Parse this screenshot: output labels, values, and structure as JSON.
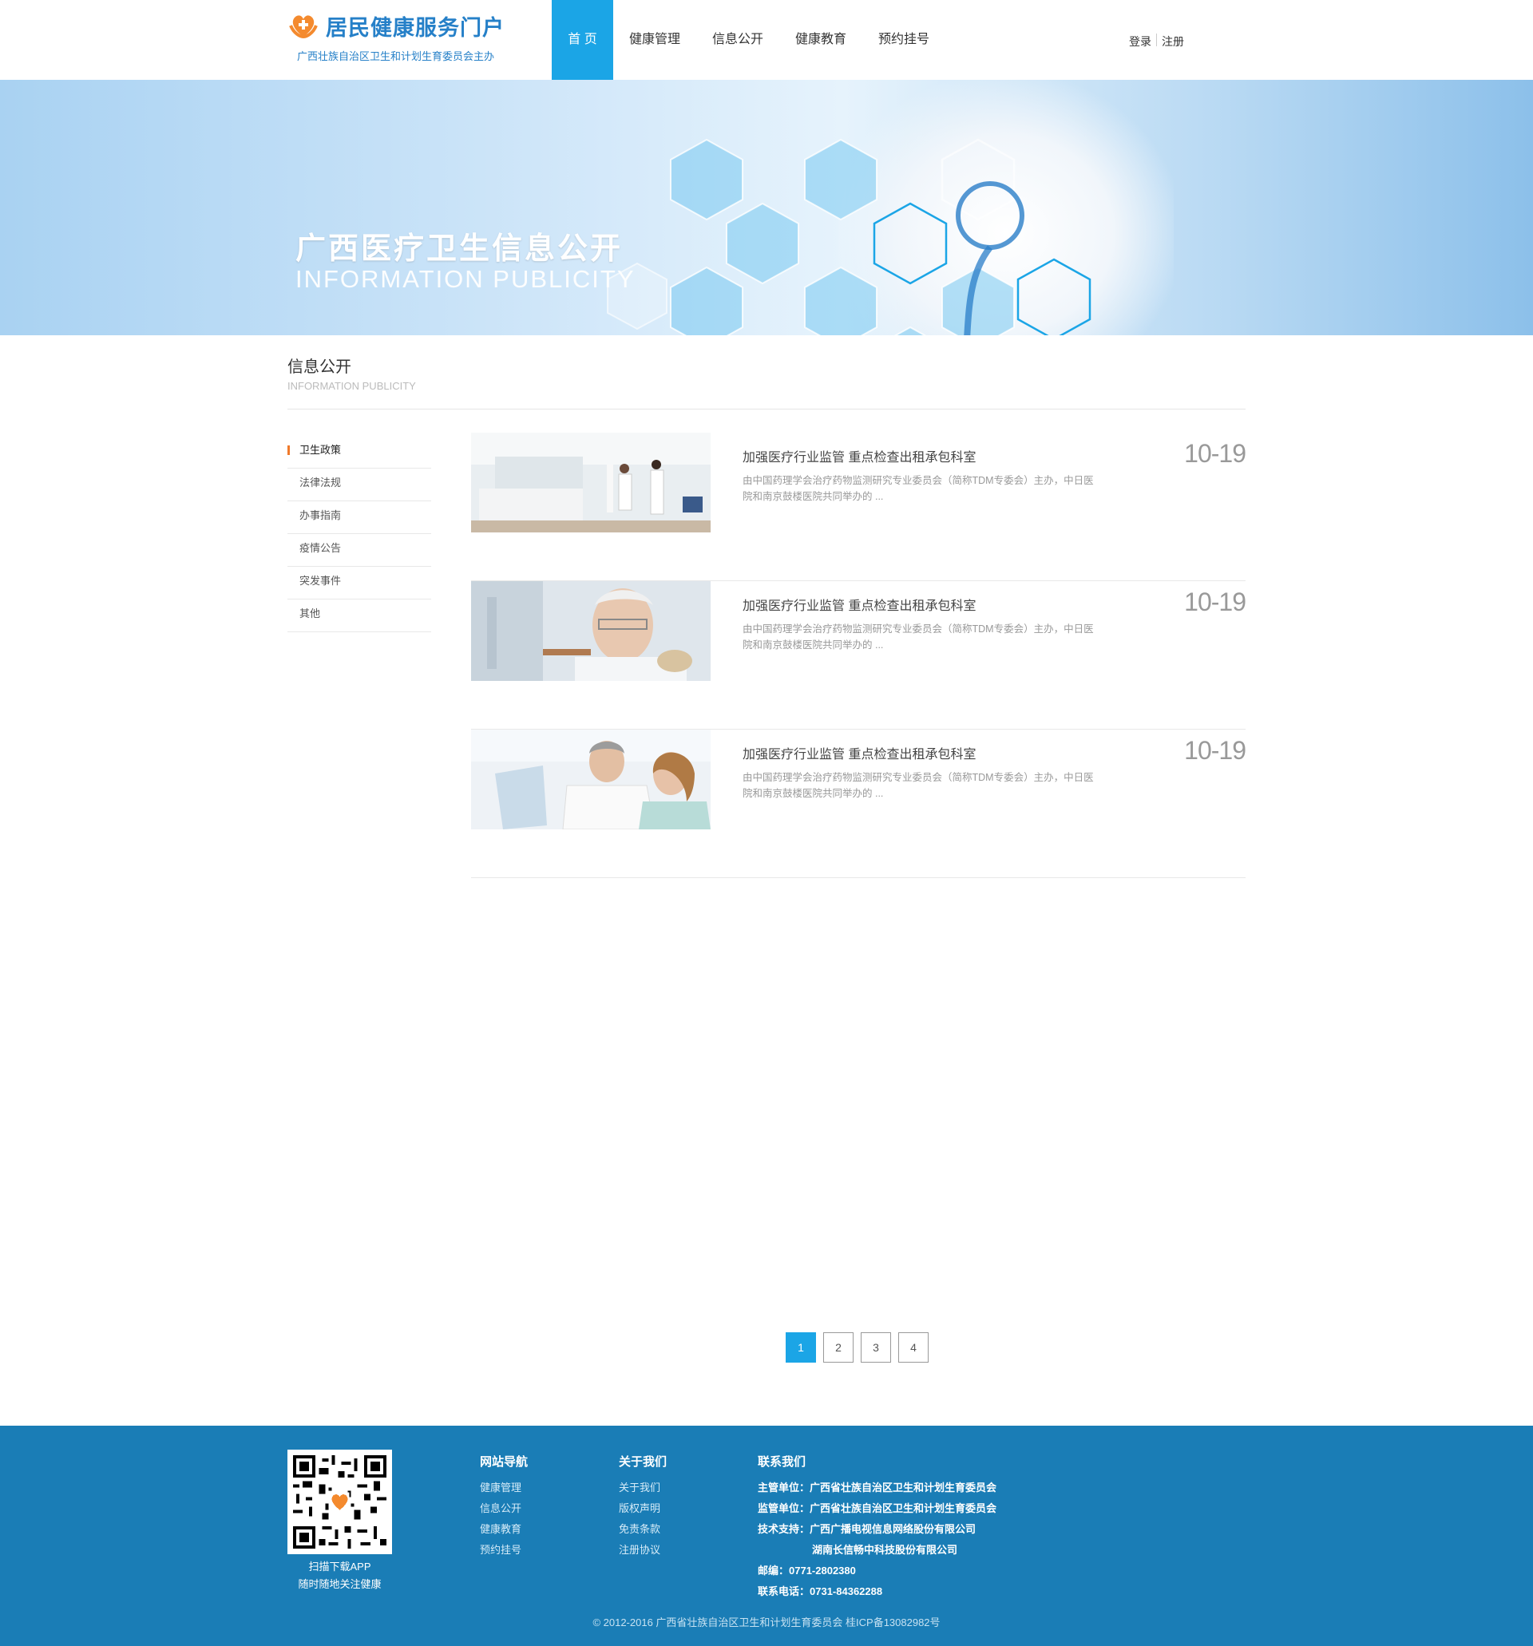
{
  "header": {
    "logo_title": "居民健康服务门户",
    "logo_sub": "广西壮族自治区卫生和计划生育委员会主办",
    "nav": [
      "首 页",
      "健康管理",
      "信息公开",
      "健康教育",
      "预约挂号"
    ],
    "login": "登录",
    "register": "注册"
  },
  "banner": {
    "title": "广西医疗卫生信息公开",
    "subtitle": "INFORMATION PUBLICITY"
  },
  "section": {
    "title": "信息公开",
    "subtitle": "INFORMATION PUBLICITY"
  },
  "side_menu": [
    "卫生政策",
    "法律法规",
    "办事指南",
    "疫情公告",
    "突发事件",
    "其他"
  ],
  "articles": [
    {
      "title": "加强医疗行业监管 重点检查出租承包科室",
      "desc": "由中国药理学会治疗药物监测研究专业委员会（简称TDM专委会）主办，中日医院和南京鼓楼医院共同举办的 ...",
      "date": "10-19"
    },
    {
      "title": "加强医疗行业监管 重点检查出租承包科室",
      "desc": "由中国药理学会治疗药物监测研究专业委员会（简称TDM专委会）主办，中日医院和南京鼓楼医院共同举办的 ...",
      "date": "10-19"
    },
    {
      "title": "加强医疗行业监管 重点检查出租承包科室",
      "desc": "由中国药理学会治疗药物监测研究专业委员会（简称TDM专委会）主办，中日医院和南京鼓楼医院共同举办的 ...",
      "date": "10-19"
    }
  ],
  "pagination": [
    "1",
    "2",
    "3",
    "4"
  ],
  "footer": {
    "qr_caption1": "扫描下载APP",
    "qr_caption2": "随时随地关注健康",
    "nav_title": "网站导航",
    "nav_links": [
      "健康管理",
      "信息公开",
      "健康教育",
      "预约挂号"
    ],
    "about_title": "关于我们",
    "about_links": [
      "关于我们",
      "版权声明",
      "免责条款",
      "注册协议"
    ],
    "contact_title": "联系我们",
    "contact_lines": [
      "主管单位：广西省壮族自治区卫生和计划生育委员会",
      "监管单位：广西省壮族自治区卫生和计划生育委员会",
      "技术支持：广西广播电视信息网络股份有限公司",
      "湖南长信畅中科技股份有限公司",
      "邮编：0771-2802380",
      "联系电话：0731-84362288"
    ],
    "copyright": "© 2012-2016 广西省壮族自治区卫生和计划生育委员会 桂ICP备13082982号"
  },
  "colors": {
    "accent": "#1ba5e6",
    "footer": "#1a7db6",
    "logo": "#2680c8",
    "marker": "#f07a2b"
  }
}
